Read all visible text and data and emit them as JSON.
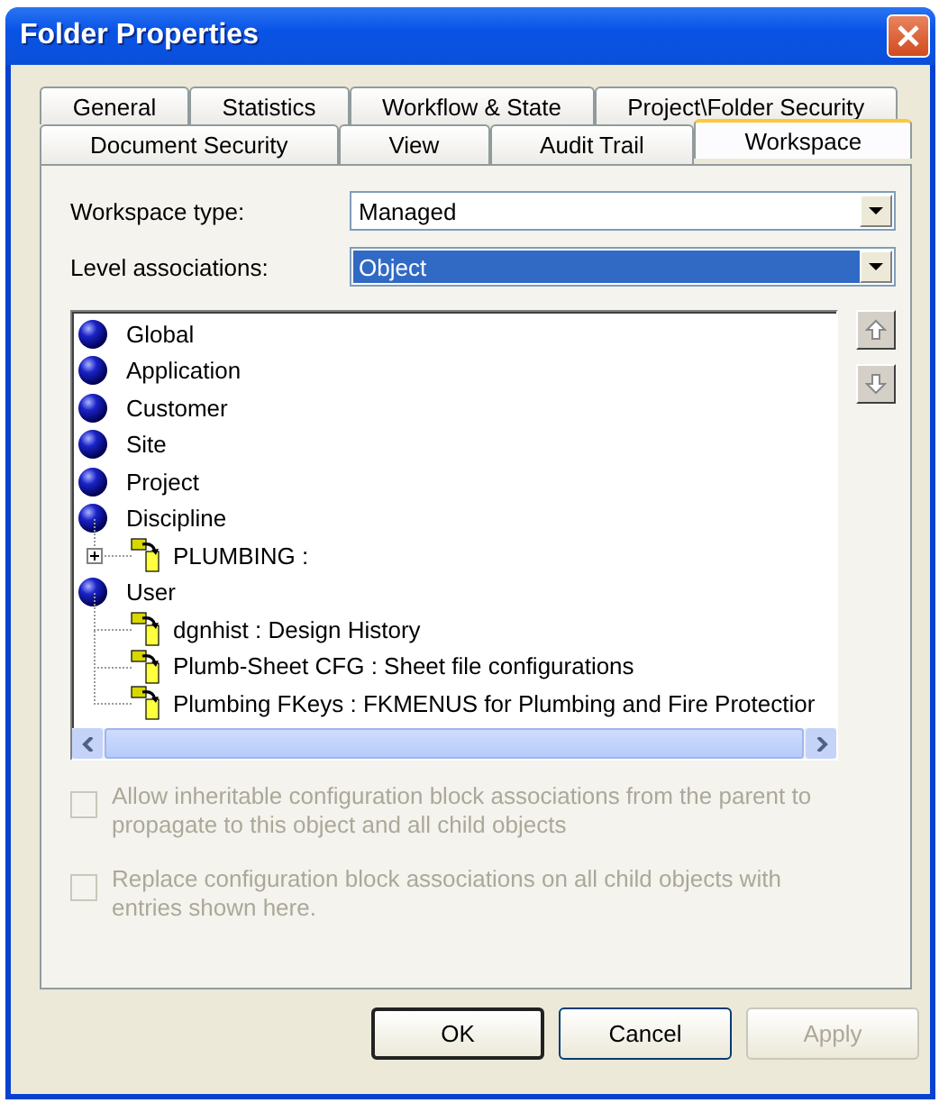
{
  "window": {
    "title": "Folder Properties"
  },
  "tab_rows": [
    [
      {
        "label": "General",
        "selected": false
      },
      {
        "label": "Statistics",
        "selected": false
      },
      {
        "label": "Workflow & State",
        "selected": false
      },
      {
        "label": "Project\\Folder Security",
        "selected": false
      }
    ],
    [
      {
        "label": "Document Security",
        "selected": false
      },
      {
        "label": "View",
        "selected": false
      },
      {
        "label": "Audit Trail",
        "selected": false
      },
      {
        "label": "Workspace",
        "selected": true
      }
    ]
  ],
  "fields": [
    {
      "label": "Workspace type:",
      "value": "Managed",
      "focused": false
    },
    {
      "label": "Level associations:",
      "value": "Object",
      "focused": true
    }
  ],
  "tree": [
    {
      "label": "Global",
      "kind": "level"
    },
    {
      "label": "Application",
      "kind": "level"
    },
    {
      "label": "Customer",
      "kind": "level"
    },
    {
      "label": "Site",
      "kind": "level"
    },
    {
      "label": "Project",
      "kind": "level"
    },
    {
      "label": "Discipline",
      "kind": "level",
      "children": [
        {
          "label": "PLUMBING :",
          "kind": "config",
          "expanded": false,
          "has_children": true
        }
      ]
    },
    {
      "label": "User",
      "kind": "level",
      "children": [
        {
          "label": "dgnhist : Design History",
          "kind": "config"
        },
        {
          "label": "Plumb-Sheet CFG : Sheet file configurations",
          "kind": "config"
        },
        {
          "label": "Plumbing FKeys : FKMENUS for Plumbing and Fire Protectior",
          "kind": "config"
        }
      ]
    }
  ],
  "options": [
    {
      "label": "Allow inheritable configuration block associations from the parent to propagate to this object and all child objects",
      "checked": false,
      "disabled": true
    },
    {
      "label": "Replace configuration block associations on all child objects with entries shown here.",
      "checked": false,
      "disabled": true
    }
  ],
  "buttons": [
    {
      "label": "OK",
      "default": true,
      "disabled": false
    },
    {
      "label": "Cancel",
      "default": false,
      "disabled": false
    },
    {
      "label": "Apply",
      "default": false,
      "disabled": true
    }
  ]
}
